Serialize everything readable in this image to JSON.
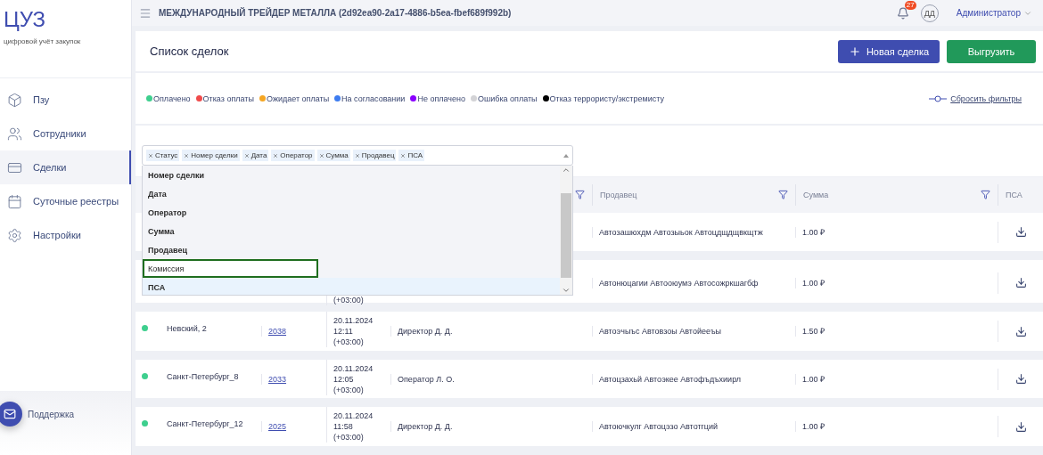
{
  "sidebar": {
    "logo": "ЦУЗ",
    "tagline": "цифровой учёт закупок",
    "items": [
      {
        "label": "Пзу",
        "selected": false
      },
      {
        "label": "Сотрудники",
        "selected": false
      },
      {
        "label": "Сделки",
        "selected": true
      },
      {
        "label": "Суточные реестры",
        "selected": false
      },
      {
        "label": "Настройки",
        "selected": false
      }
    ],
    "support": "Поддержка"
  },
  "topbar": {
    "title": "МЕЖДУНАРОДНЫЙ ТРЕЙДЕР МЕТАЛЛА (2d92ea90-2a17-4886-b5ea-fbef689f992b)",
    "notifications": "27",
    "avatar": "ДД",
    "user": "Администратор"
  },
  "page": {
    "title": "Список сделок",
    "buttons": [
      {
        "label": "Новая сделка",
        "kind": "primary"
      },
      {
        "label": "Выгрузить",
        "kind": "success"
      }
    ]
  },
  "legend": {
    "items": [
      {
        "label": "Оплачено",
        "color": "#3ecf8e"
      },
      {
        "label": "Отказ оплаты",
        "color": "#f04b4b"
      },
      {
        "label": "Ожидает оплаты",
        "color": "#f5a623"
      },
      {
        "label": "На согласовании",
        "color": "#3d7cf0"
      },
      {
        "label": "Не оплачено",
        "color": "#8a00ff"
      },
      {
        "label": "Ошибка оплаты",
        "color": "#d3d3d6"
      },
      {
        "label": "Отказ террористу/экстремисту",
        "color": "#000000"
      }
    ],
    "reset": "Сбросить фильтры"
  },
  "column_picker": {
    "chips": [
      "Статус",
      "Номер сделки",
      "Дата",
      "Оператор",
      "Сумма",
      "Продавец",
      "ПСА"
    ],
    "options": [
      {
        "label": "Номер сделки",
        "selected": true,
        "focused": false,
        "highlighted": false
      },
      {
        "label": "Дата",
        "selected": true,
        "focused": false,
        "highlighted": false
      },
      {
        "label": "Оператор",
        "selected": true,
        "focused": false,
        "highlighted": false
      },
      {
        "label": "Сумма",
        "selected": true,
        "focused": false,
        "highlighted": false
      },
      {
        "label": "Продавец",
        "selected": true,
        "focused": false,
        "highlighted": false
      },
      {
        "label": "Комиссия",
        "selected": false,
        "focused": true,
        "highlighted": false
      },
      {
        "label": "ПСА",
        "selected": true,
        "focused": false,
        "highlighted": true
      }
    ]
  },
  "table": {
    "columns": [
      {
        "filter": true
      },
      {
        "label": "Продавец",
        "filter": true
      },
      {
        "label": "Сумма",
        "filter": true
      },
      {
        "label": "ПСА",
        "filter": false
      }
    ],
    "rows": [
      {
        "seller": "Автозашюхдм Автозыьок Автоцдщдщвкщтж",
        "sum": "1.00 ₽"
      },
      {
        "date": "(+03:00)",
        "seller": "Автонюцагии Автооюумэ Автосожркшагбф",
        "sum": "1.00 ₽"
      },
      {
        "color": "#3ecf8e",
        "address": "Невский, 2",
        "number": "2038",
        "date": "20.11.2024\n12:11\n(+03:00)",
        "operator": "Директор Д. Д.",
        "seller": "Автоэчыъс Автовзоы Автойееъы",
        "sum": "1.50 ₽"
      },
      {
        "color": "#3ecf8e",
        "address": "Санкт-Петербург_8",
        "number": "2033",
        "date": "20.11.2024\n12:05\n(+03:00)",
        "operator": "Оператор Л. О.",
        "seller": "Автоцзахьй Автоэкее Автофъдъхиирл",
        "sum": "1.00 ₽"
      },
      {
        "color": "#3ecf8e",
        "address": "Санкт-Петербург_12",
        "number": "2025",
        "date": "20.11.2024\n11:58\n(+03:00)",
        "operator": "Директор Д. Д.",
        "seller": "Автоючкулг Автоцэзо Автотгций",
        "sum": "1.00 ₽"
      }
    ]
  }
}
